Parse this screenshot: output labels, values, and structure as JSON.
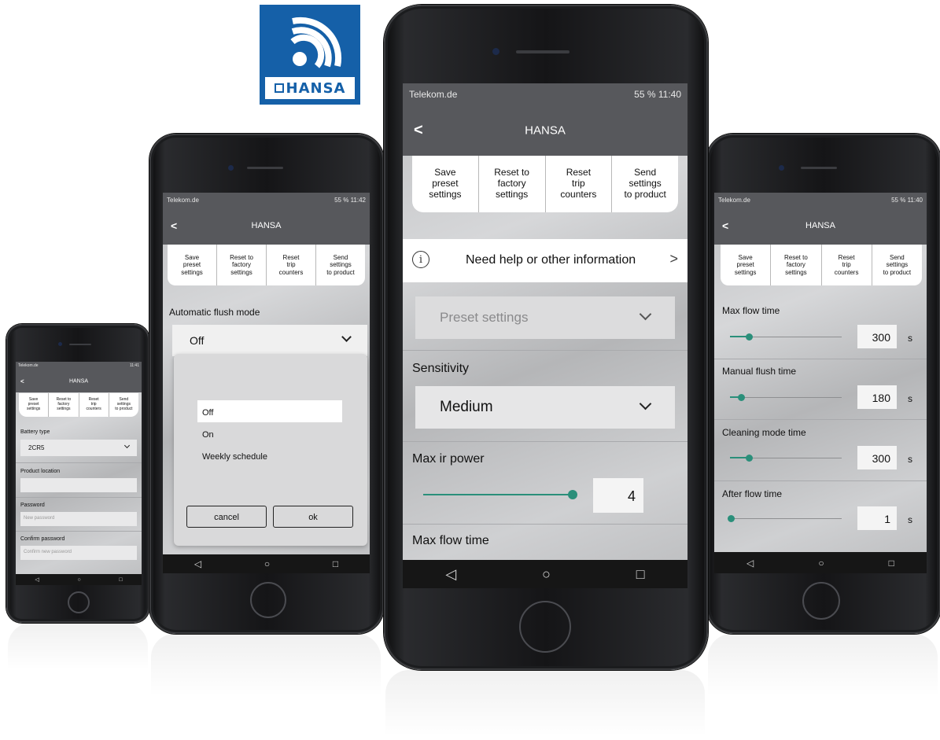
{
  "logo": {
    "brand": "HANSA"
  },
  "status": {
    "carrier": "Telekom.de",
    "battery": "55 %",
    "time_left": "11:42",
    "time_center": "11:40",
    "time_right": "11:40",
    "time_small": "11:41"
  },
  "header": {
    "title": "HANSA",
    "back_icon": "chevron-left-icon"
  },
  "toolbar": {
    "save": "Save\npreset\nsettings",
    "reset_factory": "Reset to\nfactory\nsettings",
    "reset_trip": "Reset\ntrip\ncounters",
    "send": "Send\nsettings\nto product"
  },
  "sysnav": {
    "back": "◁",
    "home": "○",
    "recents": "□"
  },
  "phone_small": {
    "battery_type_label": "Battery type",
    "battery_type_value": "2CR5",
    "product_location_label": "Product location",
    "password_label": "Password",
    "password_placeholder": "New password",
    "confirm_label": "Confirm password",
    "confirm_placeholder": "Confirm new password"
  },
  "phone_left": {
    "auto_flush_label": "Automatic flush mode",
    "auto_flush_value": "Off",
    "options": [
      "Off",
      "On",
      "Weekly schedule"
    ],
    "cancel": "cancel",
    "ok": "ok"
  },
  "phone_center": {
    "help_text": "Need help or other information",
    "help_icon": "info-icon",
    "preset_placeholder": "Preset settings",
    "sensitivity_label": "Sensitivity",
    "sensitivity_value": "Medium",
    "ir_label": "Max ir power",
    "ir_value": "4",
    "max_flow_label": "Max flow time"
  },
  "phone_right": {
    "rows": [
      {
        "label": "Max flow time",
        "value": "300",
        "unit": "s"
      },
      {
        "label": "Manual flush time",
        "value": "180",
        "unit": "s"
      },
      {
        "label": "Cleaning mode time",
        "value": "300",
        "unit": "s"
      },
      {
        "label": "After flow time",
        "value": "1",
        "unit": "s"
      }
    ]
  },
  "colors": {
    "accent": "#2a8f7a",
    "logo_blue": "#1560a8",
    "bar": "#57585c"
  }
}
